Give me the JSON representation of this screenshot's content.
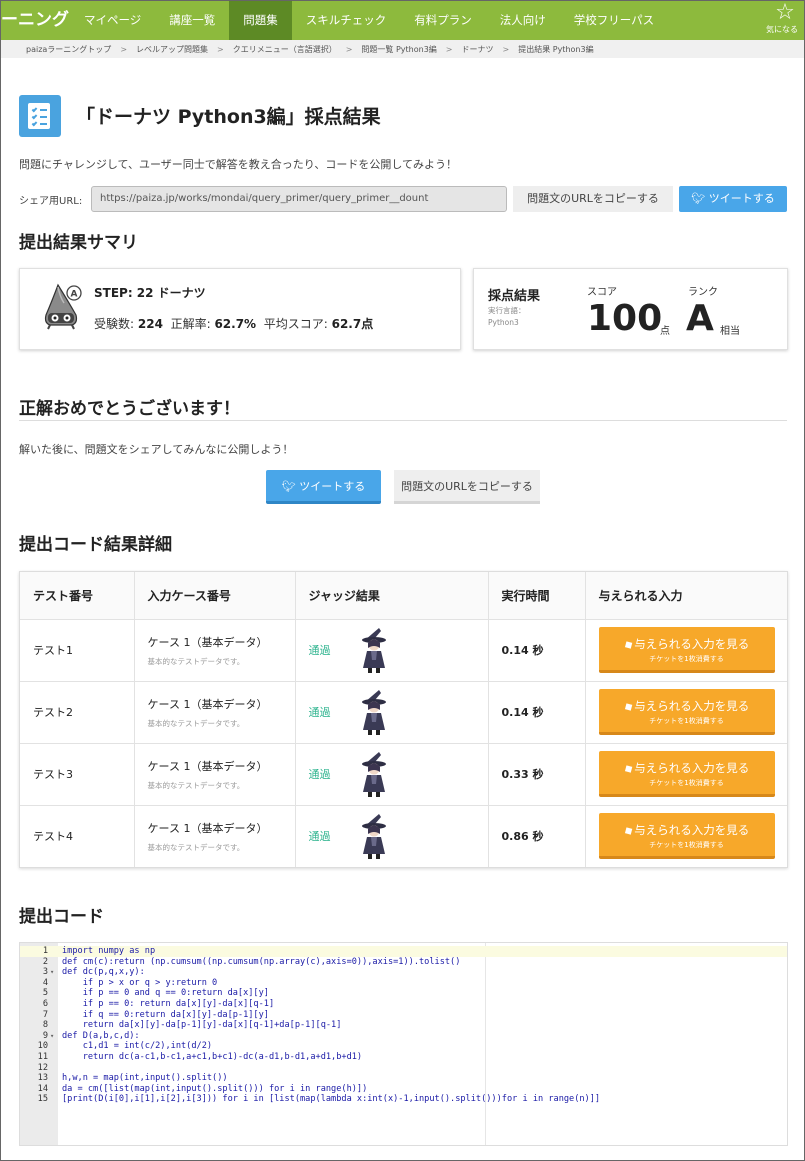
{
  "nav": {
    "brand": "ーニング",
    "items": [
      "マイページ",
      "講座一覧",
      "問題集",
      "スキルチェック",
      "有料プラン",
      "法人向け",
      "学校フリーパス"
    ],
    "active_index": 2,
    "favorite_label": "気になる",
    "favorite_icon": "star-icon",
    "bg_color": "#8dba3d",
    "active_color": "#5d8a25"
  },
  "breadcrumb": [
    "paizaラーニングトップ",
    "レベルアップ問題集",
    "クエリメニュー（言語選択）",
    "問題一覧 Python3編",
    "ドーナツ",
    "提出結果 Python3編"
  ],
  "header": {
    "icon": "checklist-icon",
    "title": "「ドーナツ Python3編」採点結果",
    "intro": "問題にチャレンジして、ユーザー同士で解答を教え合ったり、コードを公開してみよう！"
  },
  "share": {
    "label": "シェア用URL:",
    "url": "https://paiza.jp/works/mondai/query_primer/query_primer__dount",
    "copy_label": "問題文のURLをコピーする",
    "tweet_label": "ツイートする",
    "tweet_icon": "twitter-bird-icon"
  },
  "summary": {
    "heading": "提出結果サマリ",
    "step": "STEP: 22 ドーナツ",
    "stats": {
      "examinees_label": "受験数:",
      "examinees": "224",
      "accuracy_label": "正解率:",
      "accuracy": "62.7%",
      "avg_label": "平均スコア:",
      "avg": "62.7点"
    },
    "result_label": "採点結果",
    "lang_label": "実行言語：",
    "lang": "Python3",
    "score_label": "スコア",
    "score": "100",
    "score_unit": "点",
    "rank_label": "ランク",
    "rank": "A",
    "rank_unit": "相当"
  },
  "congrats": {
    "heading": "正解おめでとうございます！",
    "sub": "解いた後に、問題文をシェアしてみんなに公開しよう！",
    "tweet_label": "ツイートする",
    "copy_label": "問題文のURLをコピーする"
  },
  "details": {
    "heading": "提出コード結果詳細",
    "columns": [
      "テスト番号",
      "入力ケース番号",
      "ジャッジ結果",
      "実行時間",
      "与えられる入力"
    ],
    "rows": [
      {
        "test": "テスト1",
        "case": "ケース 1（基本データ）",
        "desc": "基本的なテストデータです。",
        "judge": "通過",
        "time": "0.14 秒"
      },
      {
        "test": "テスト2",
        "case": "ケース 1（基本データ）",
        "desc": "基本的なテストデータです。",
        "judge": "通過",
        "time": "0.14 秒"
      },
      {
        "test": "テスト3",
        "case": "ケース 1（基本データ）",
        "desc": "基本的なテストデータです。",
        "judge": "通過",
        "time": "0.33 秒"
      },
      {
        "test": "テスト4",
        "case": "ケース 1（基本データ）",
        "desc": "基本的なテストデータです。",
        "judge": "通過",
        "time": "0.86 秒"
      }
    ],
    "input_button_l1": "与えられる入力を見る",
    "input_button_l2": "チケットを1枚消費する",
    "input_button_icon": "ticket-icon",
    "judge_color": "#2fb48f",
    "button_color": "#f7a82a"
  },
  "code": {
    "heading": "提出コード",
    "lines": [
      {
        "n": "1",
        "fold": "",
        "text": "import numpy as np"
      },
      {
        "n": "2",
        "fold": "",
        "text": "def cm(c):return (np.cumsum((np.cumsum(np.array(c),axis=0)),axis=1)).tolist()"
      },
      {
        "n": "3",
        "fold": "▾",
        "text": "def dc(p,q,x,y):"
      },
      {
        "n": "4",
        "fold": "",
        "text": "    if p > x or q > y:return 0"
      },
      {
        "n": "5",
        "fold": "",
        "text": "    if p == 0 and q == 0:return da[x][y]"
      },
      {
        "n": "6",
        "fold": "",
        "text": "    if p == 0: return da[x][y]-da[x][q-1]"
      },
      {
        "n": "7",
        "fold": "",
        "text": "    if q == 0:return da[x][y]-da[p-1][y]"
      },
      {
        "n": "8",
        "fold": "",
        "text": "    return da[x][y]-da[p-1][y]-da[x][q-1]+da[p-1][q-1]"
      },
      {
        "n": "9",
        "fold": "▾",
        "text": "def D(a,b,c,d):"
      },
      {
        "n": "10",
        "fold": "",
        "text": "    c1,d1 = int(c/2),int(d/2)"
      },
      {
        "n": "11",
        "fold": "",
        "text": "    return dc(a-c1,b-c1,a+c1,b+c1)-dc(a-d1,b-d1,a+d1,b+d1)"
      },
      {
        "n": "12",
        "fold": "",
        "text": ""
      },
      {
        "n": "13",
        "fold": "",
        "text": "h,w,n = map(int,input().split())"
      },
      {
        "n": "14",
        "fold": "",
        "text": "da = cm([list(map(int,input().split())) for i in range(h)])"
      },
      {
        "n": "15",
        "fold": "",
        "text": "[print(D(i[0],i[1],i[2],i[3])) for i in [list(map(lambda x:int(x)-1,input().split()))for i in range(n)]]"
      }
    ]
  }
}
